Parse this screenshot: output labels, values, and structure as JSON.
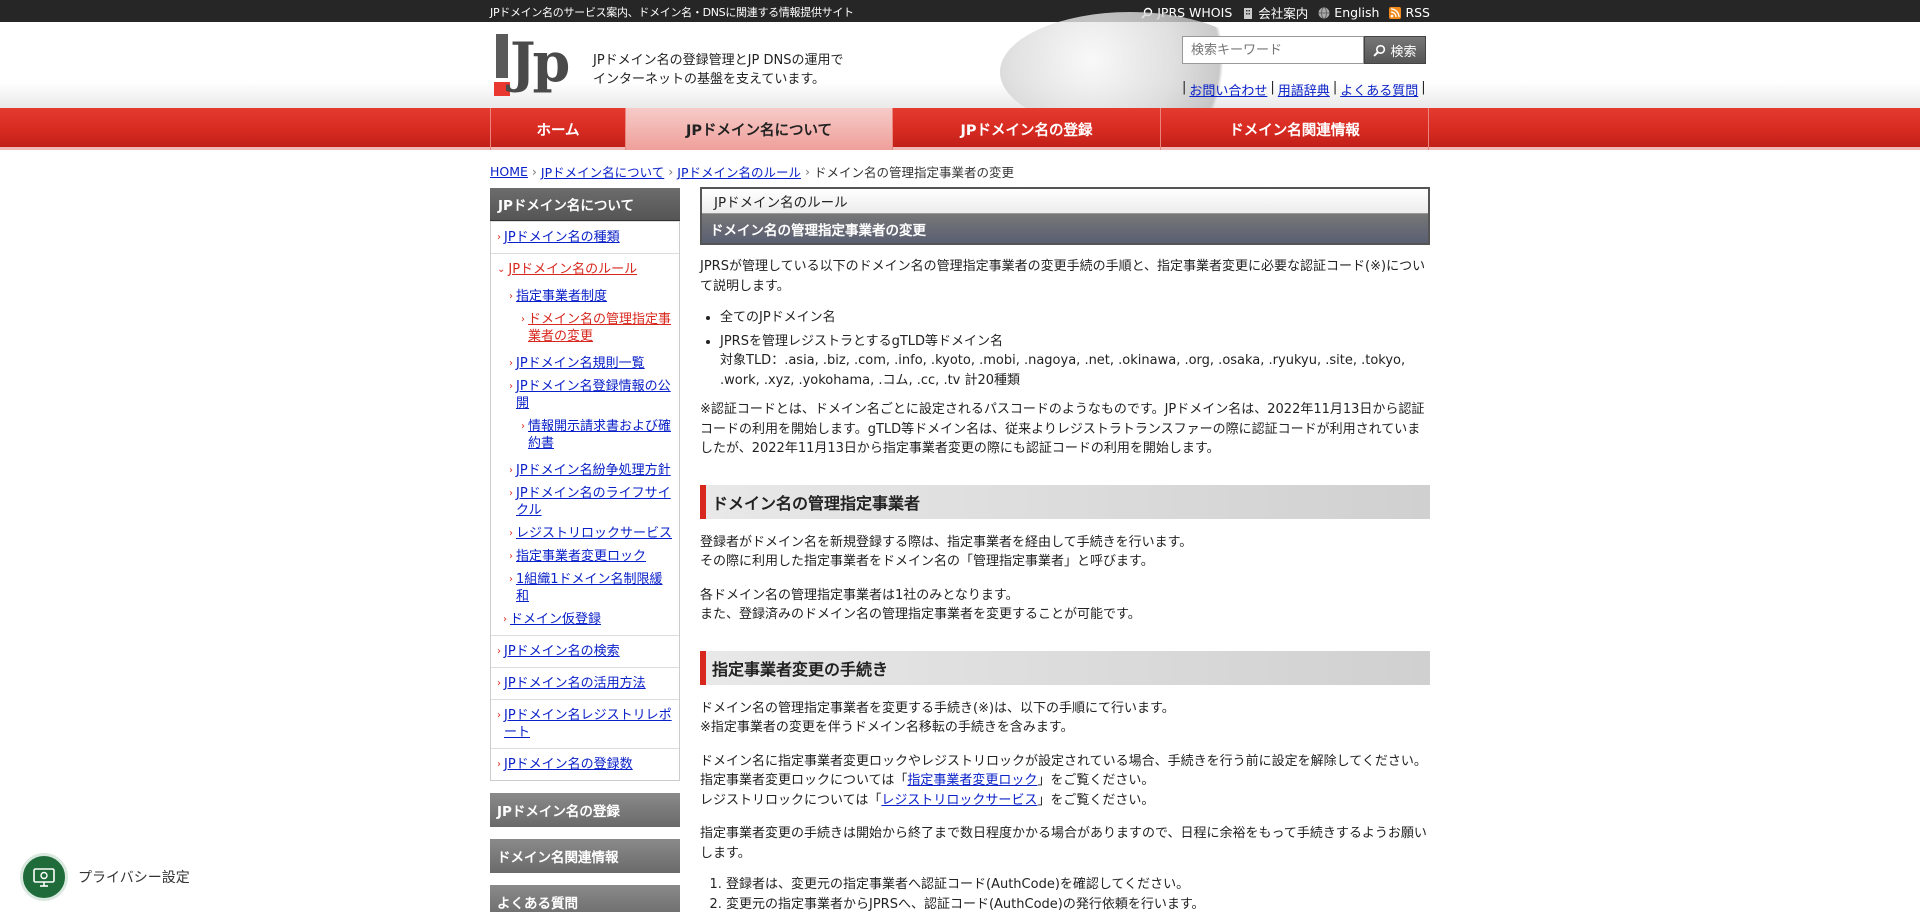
{
  "topbar": {
    "tagline": "JPドメイン名のサービス案内、ドメイン名・DNSに関連する情報提供サイト",
    "links": [
      "JPRS WHOIS",
      "会社案内",
      "English",
      "RSS"
    ]
  },
  "header": {
    "logo_text": "Jp",
    "slogan_line1": "JPドメイン名の登録管理とJP DNSの運用で",
    "slogan_line2": "インターネットの基盤を支えています。",
    "search_placeholder": "検索キーワード",
    "search_button": "検索",
    "sublinks": [
      "お問い合わせ",
      "用語辞典",
      "よくある質問"
    ]
  },
  "nav": {
    "tabs": [
      {
        "label": "ホーム"
      },
      {
        "label": "JPドメイン名について"
      },
      {
        "label": "JPドメイン名の登録"
      },
      {
        "label": "ドメイン名関連情報"
      }
    ]
  },
  "breadcrumb": [
    "HOME",
    "JPドメイン名について",
    "JPドメイン名のルール",
    "ドメイン名の管理指定事業者の変更"
  ],
  "sidebar": {
    "head": "JPドメイン名について",
    "items": {
      "types": "JPドメイン名の種類",
      "rules": "JPドメイン名のルール",
      "designated": "指定事業者制度",
      "change": "ドメイン名の管理指定事業者の変更",
      "rules_list": "JPドメイン名規則一覧",
      "reg_info": "JPドメイン名登録情報の公開",
      "disclosure": "情報開示請求書および確約書",
      "dispute": "JPドメイン名紛争処理方針",
      "lifecycle": "JPドメイン名のライフサイクル",
      "registry_lock": "レジストリロックサービス",
      "transfer_lock": "指定事業者変更ロック",
      "relax": "1組織1ドメイン名制限緩和",
      "provisional": "ドメイン仮登録",
      "search": "JPドメイン名の検索",
      "usage": "JPドメイン名の活用方法",
      "report": "JPドメイン名レジストリレポート",
      "count": "JPドメイン名の登録数"
    },
    "head2": "JPドメイン名の登録",
    "head3": "ドメイン名関連情報",
    "head4": "よくある質問"
  },
  "main": {
    "title_top": "JPドメイン名のルール",
    "title_bottom": "ドメイン名の管理指定事業者の変更",
    "intro": "JPRSが管理している以下のドメイン名の管理指定事業者の変更手続の手順と、指定事業者変更に必要な認証コード(※)について説明します。",
    "bullet1": "全てのJPドメイン名",
    "bullet2": "JPRSを管理レジストラとするgTLD等ドメイン名",
    "bullet2_sub": "対象TLD：.asia, .biz, .com, .info, .kyoto, .mobi, .nagoya, .net, .okinawa, .org, .osaka, .ryukyu, .site, .tokyo, .work, .xyz, .yokohama, .コム, .cc, .tv 計20種類",
    "note": "※認証コードとは、ドメイン名ごとに設定されるパスコードのようなものです。JPドメイン名は、2022年11月13日から認証コードの利用を開始します。gTLD等ドメイン名は、従来よりレジストラトランスファーの際に認証コードが利用されていましたが、2022年11月13日から指定事業者変更の際にも認証コードの利用を開始します。",
    "h2_1": "ドメイン名の管理指定事業者",
    "s1_p1_l1": "登録者がドメイン名を新規登録する際は、指定事業者を経由して手続きを行います。",
    "s1_p1_l2": "その際に利用した指定事業者をドメイン名の「管理指定事業者」と呼びます。",
    "s1_p2_l1": "各ドメイン名の管理指定事業者は1社のみとなります。",
    "s1_p2_l2": "また、登録済みのドメイン名の管理指定事業者を変更することが可能です。",
    "h2_2": "指定事業者変更の手続き",
    "s2_p1_l1": "ドメイン名の管理指定事業者を変更する手続き(※)は、以下の手順にて行います。",
    "s2_p1_l2": "※指定事業者の変更を伴うドメイン名移転の手続きを含みます。",
    "s2_p2_l1": "ドメイン名に指定事業者変更ロックやレジストリロックが設定されている場合、手続きを行う前に設定を解除してください。",
    "s2_p2_l2_pre": "指定事業者変更ロックについては「",
    "s2_p2_l2_link": "指定事業者変更ロック",
    "s2_p2_l2_post": "」をご覧ください。",
    "s2_p2_l3_pre": "レジストリロックについては「",
    "s2_p2_l3_link": "レジストリロックサービス",
    "s2_p2_l3_post": "」をご覧ください。",
    "s2_p3": "指定事業者変更の手続きは開始から終了まで数日程度かかる場合がありますので、日程に余裕をもって手続きするようお願いします。",
    "step1": "登録者は、変更元の指定事業者へ認証コード(AuthCode)を確認してください。",
    "step2": "変更元の指定事業者からJPRSへ、認証コード(AuthCode)の発行依頼を行います。"
  },
  "privacy": {
    "label": "プライバシー設定"
  }
}
